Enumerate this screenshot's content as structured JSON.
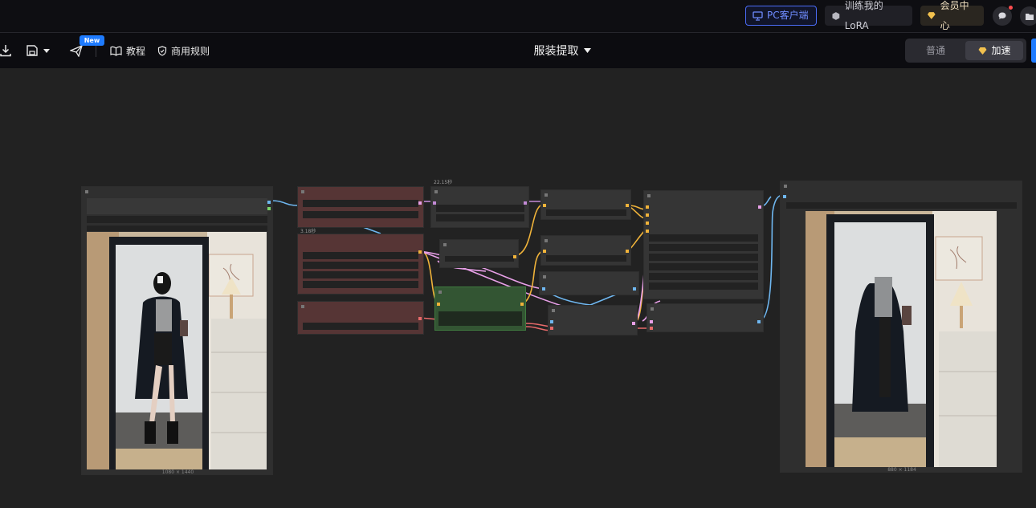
{
  "topbar": {
    "pc_client": "PC客户端",
    "train_lora": "训练我的LoRA",
    "member_center": "会员中心"
  },
  "toolbar": {
    "new_badge": "New",
    "tutorial": "教程",
    "commercial_rules": "商用规则",
    "workflow_title": "服装提取",
    "mode_normal": "普通",
    "mode_fast": "加速"
  },
  "canvas": {
    "input_image_size": "1080 × 1440",
    "output_image_size": "880 × 1184",
    "timer_1": "22.15秒",
    "timer_2": "3.18秒"
  },
  "colors": {
    "accent_blue": "#1e7bff",
    "pc_border": "#4b6cf7",
    "red_node": "#563535",
    "green_node": "#335533",
    "wire_blue": "#6fb7f0",
    "wire_yellow": "#f0b33a",
    "wire_pink": "#e8a0e8",
    "wire_red": "#e86a6a"
  }
}
